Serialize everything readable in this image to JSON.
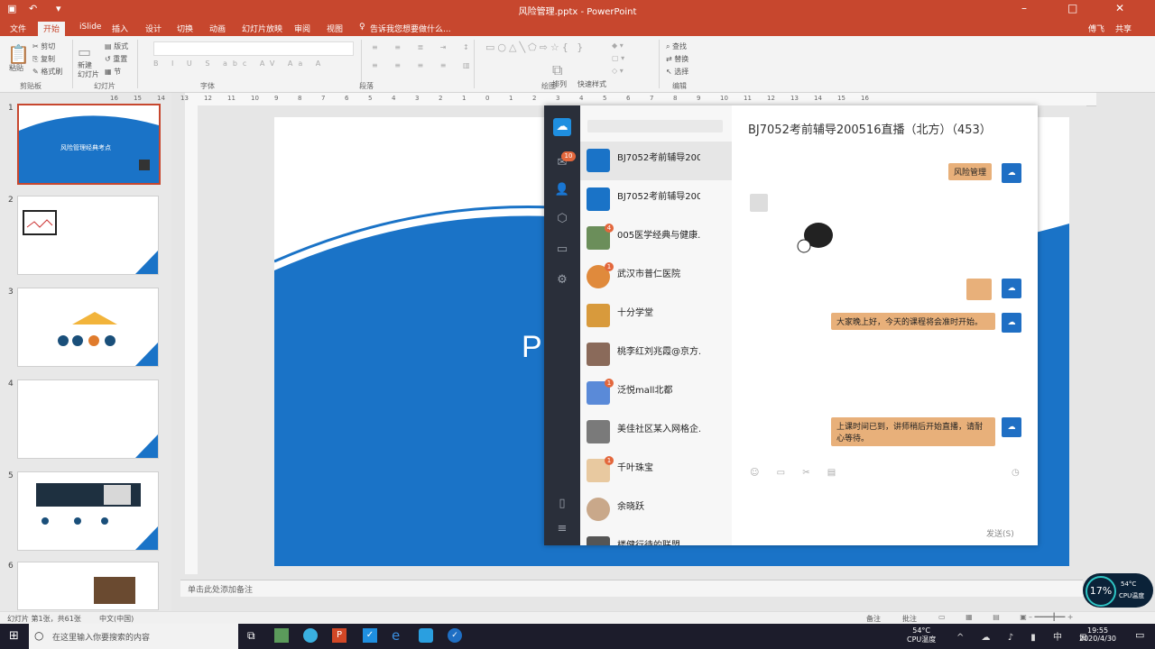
{
  "window": {
    "title": "风险管理.pptx - PowerPoint",
    "user": "傅飞",
    "share": "共享"
  },
  "tabs": [
    {
      "label": "文件"
    },
    {
      "label": "开始"
    },
    {
      "label": "iSlide"
    },
    {
      "label": "插入"
    },
    {
      "label": "设计"
    },
    {
      "label": "切换"
    },
    {
      "label": "动画"
    },
    {
      "label": "幻灯片放映"
    },
    {
      "label": "审阅"
    },
    {
      "label": "视图"
    }
  ],
  "tell_me": "告诉我您想要做什么...",
  "ribbon": {
    "paste": "粘贴",
    "cut": "剪切",
    "copy": "复制",
    "format_painter": "格式刷",
    "new_slide": "新建\n幻灯片",
    "layout": "版式",
    "reset": "重置",
    "section": "节",
    "arrange": "排列",
    "quick_styles": "快速样式",
    "find": "查找",
    "replace": "替换",
    "select": "选择",
    "groups": [
      "剪贴板",
      "幻灯片",
      "字体",
      "段落",
      "绘图",
      "编辑"
    ]
  },
  "ruler": {
    "ticks": [
      "16",
      "15",
      "14",
      "13",
      "12",
      "11",
      "10",
      "9",
      "8",
      "7",
      "6",
      "5",
      "4",
      "3",
      "2",
      "1",
      "0",
      "1",
      "2",
      "3",
      "4",
      "5",
      "6",
      "7",
      "8",
      "9",
      "10",
      "11",
      "12",
      "13",
      "14",
      "15",
      "16"
    ]
  },
  "slides": [
    {
      "num": "1",
      "title": "风险管理经典考点"
    },
    {
      "num": "2"
    },
    {
      "num": "3"
    },
    {
      "num": "4"
    },
    {
      "num": "5"
    },
    {
      "num": "6"
    }
  ],
  "slide_letter": "P",
  "notes_placeholder": "单击此处添加备注",
  "status": {
    "slide_info": "幻灯片 第1张，共61张",
    "language": "中文(中国)",
    "notes": "备注",
    "comments": "批注"
  },
  "chat": {
    "title": "BJ7052考前辅导200516直播（北方）（453）",
    "unread_badge": "10",
    "conversations": [
      {
        "name": "BJ7052考前辅导200...",
        "preview": "",
        "time": "",
        "badge": ""
      },
      {
        "name": "BJ7052考前辅导200...",
        "preview": "",
        "time": "",
        "badge": ""
      },
      {
        "name": "005医学经典与健康...",
        "preview": "",
        "time": "",
        "badge": "4"
      },
      {
        "name": "武汉市普仁医院",
        "preview": "",
        "time": "",
        "badge": "1"
      },
      {
        "name": "十分学堂",
        "preview": "",
        "time": "",
        "badge": ""
      },
      {
        "name": "桃李红刘兆霞@京方...",
        "preview": "",
        "time": "",
        "badge": ""
      },
      {
        "name": "泛悦mall北都",
        "preview": "",
        "time": "",
        "badge": "1"
      },
      {
        "name": "美佳社区某入网格企...",
        "preview": "",
        "time": "",
        "badge": ""
      },
      {
        "name": "千叶珠宝",
        "preview": "",
        "time": "",
        "badge": "1"
      },
      {
        "name": "余晓跃",
        "preview": "",
        "time": "",
        "badge": ""
      },
      {
        "name": "楼健行待的联盟",
        "preview": "",
        "time": "",
        "badge": ""
      }
    ],
    "messages": [
      {
        "side": "right",
        "text": "风险管理"
      },
      {
        "side": "right",
        "text": "大家晚上好，今天的课程将会准时开始。"
      },
      {
        "side": "right",
        "text": "上课时间已到，讲师稍后开始直播，请耐心等待。"
      }
    ],
    "send_label": "发送(S)"
  },
  "taskbar": {
    "search_placeholder": "在这里输入你要搜索的内容",
    "temp": "54°C",
    "cpu_label": "CPU温度",
    "time": "19:55",
    "date": "2020/4/30"
  },
  "cpu_widget": {
    "percent": "17%",
    "temp": "54°C",
    "label": "CPU温度"
  }
}
